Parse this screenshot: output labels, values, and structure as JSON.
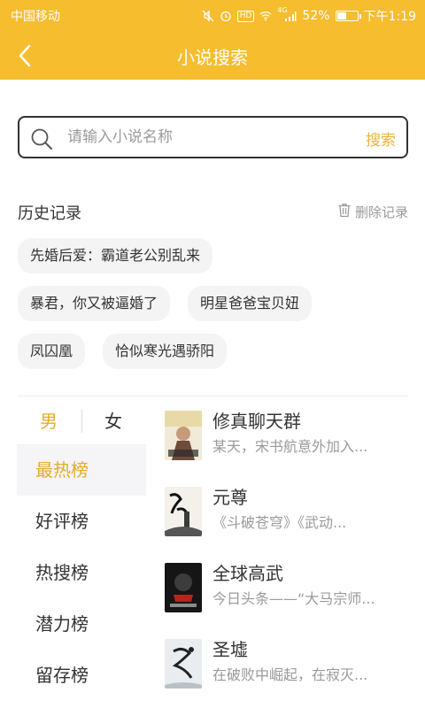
{
  "status_bar": {
    "carrier": "中国移动",
    "hd": "HD",
    "signal_label": "4G",
    "battery": "52%",
    "battery_level": 0.52,
    "time": "下午1:19"
  },
  "app_bar": {
    "title": "小说搜索",
    "back_icon": "chevron-left-icon"
  },
  "search": {
    "placeholder": "请输入小说名称",
    "value": "",
    "button_label": "搜索",
    "icon": "search-icon"
  },
  "history": {
    "title": "历史记录",
    "clear_label": "删除记录",
    "clear_icon": "trash-icon",
    "tags": [
      "先婚后爱：霸道老公别乱来",
      "暴君，你又被逼婚了",
      "明星爸爸宝贝妞",
      "凤囚凰",
      "恰似寒光遇骄阳"
    ]
  },
  "gender_tabs": {
    "male": "男",
    "female": "女",
    "selected": "男"
  },
  "rankings": {
    "items": [
      "最热榜",
      "好评榜",
      "热搜榜",
      "潜力榜",
      "留存榜"
    ],
    "active_index": 0
  },
  "books": [
    {
      "title": "修真聊天群",
      "desc": "某天，宋书航意外加入..."
    },
    {
      "title": "元尊",
      "desc": "《斗破苍穹》《武动..."
    },
    {
      "title": "全球高武",
      "desc": "今日头条——“大马宗师..."
    },
    {
      "title": "圣墟",
      "desc": "在破败中崛起，在寂灭..."
    }
  ],
  "colors": {
    "accent": "#f6bd2f",
    "highlight": "#e3ad2a",
    "muted": "#9a9a9a"
  }
}
